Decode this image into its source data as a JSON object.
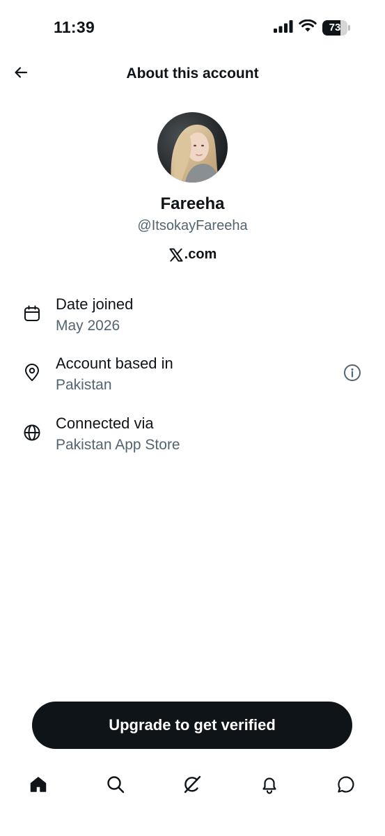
{
  "status_bar": {
    "time": "11:39",
    "battery_level": "73",
    "battery_fraction": 0.73,
    "icons": [
      "signal-icon",
      "wifi-icon",
      "battery-icon"
    ]
  },
  "header": {
    "title": "About this account",
    "back_icon": "arrow-left-icon"
  },
  "profile": {
    "display_name": "Fareeha",
    "handle": "@ItsokayFareeha",
    "via": ".com",
    "via_logo": "x-logo-icon"
  },
  "info_rows": [
    {
      "label": "Date joined",
      "value": "May 2026",
      "icon": "calendar-icon"
    },
    {
      "label": "Account based in",
      "value": "Pakistan",
      "icon": "location-pin-icon",
      "action_icon": "info-icon"
    },
    {
      "label": "Connected via",
      "value": "Pakistan App Store",
      "icon": "globe-icon"
    }
  ],
  "upgrade_button": {
    "label": "Upgrade to get verified"
  },
  "bottom_nav": {
    "items": [
      "home-icon",
      "search-icon",
      "grok-icon",
      "notifications-icon",
      "messages-icon"
    ],
    "active": "home-icon"
  },
  "colors": {
    "text_primary": "#0f1419",
    "text_secondary": "#536471",
    "button_bg": "#0f1419",
    "background": "#ffffff"
  }
}
